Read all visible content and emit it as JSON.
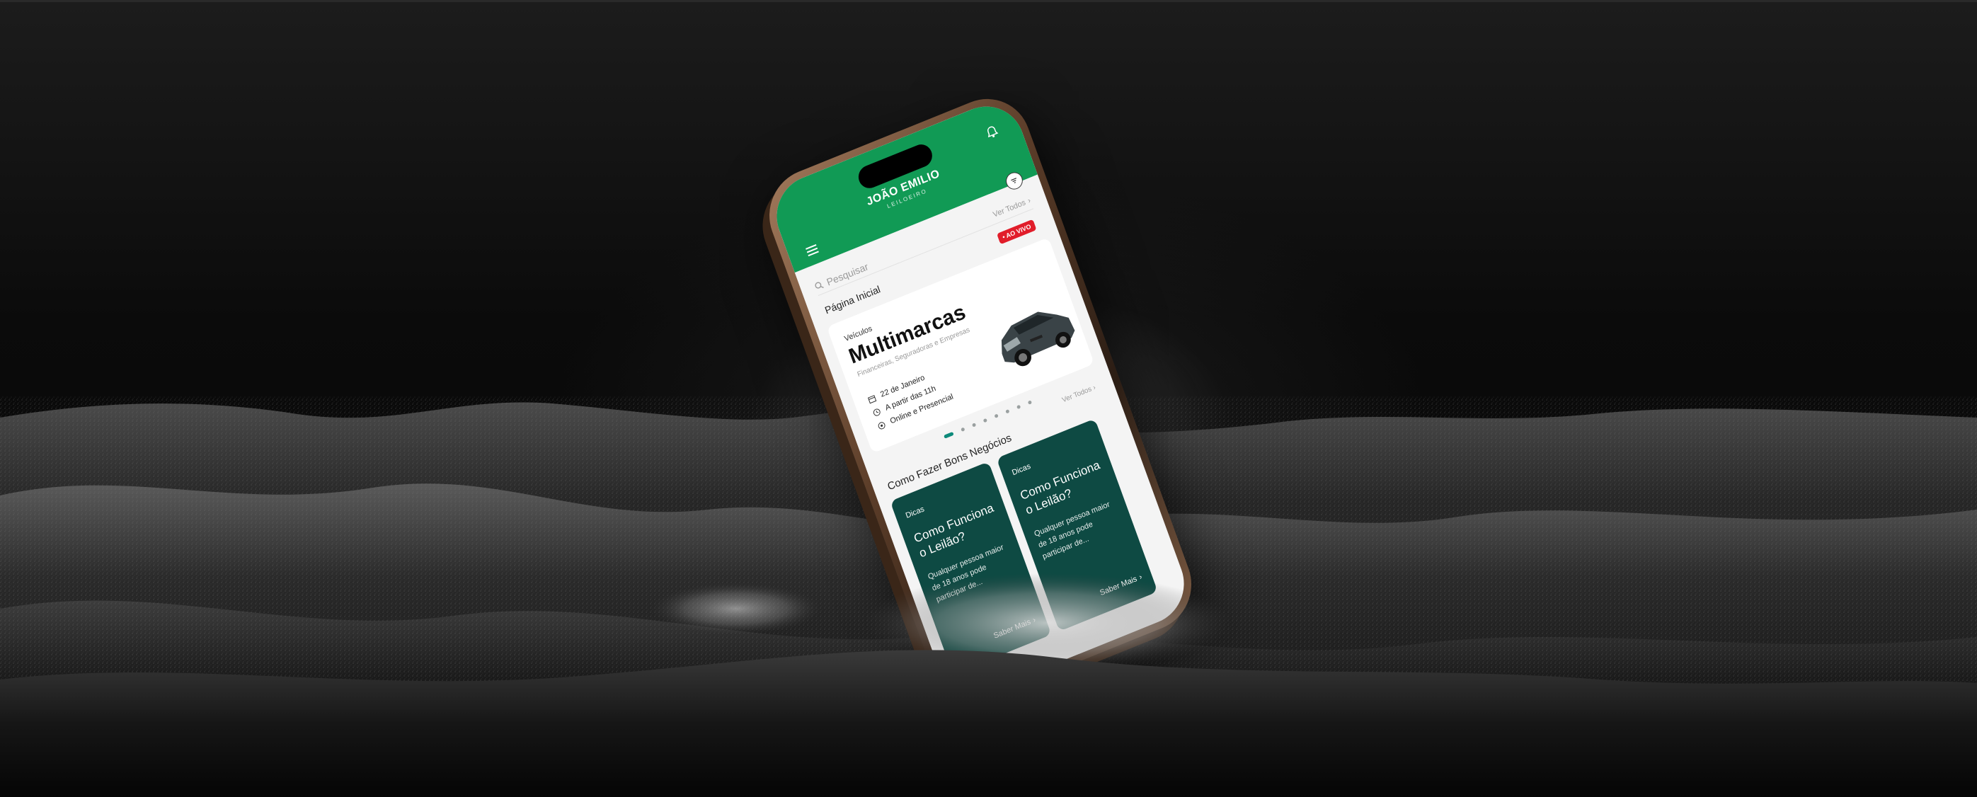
{
  "header": {
    "brand_name": "JOÃO EMILIO",
    "brand_sub": "LEILOEIRO"
  },
  "search": {
    "placeholder": "Pesquisar",
    "see_all": "Ver Todos"
  },
  "page": {
    "title": "Página Inicial"
  },
  "live_badge": "• AO VIVO",
  "event": {
    "category": "Veículos",
    "title": "Multimarcas",
    "subtitle": "Financeiras, Seguradoras e Empresas",
    "date": "22 de Janeiro",
    "time": "A partir das 11h",
    "mode": "Online e Presencial"
  },
  "carousel": {
    "dot_count": 8,
    "active_index": 0,
    "see_all": "Ver Todos"
  },
  "tips_section": {
    "title": "Como Fazer Bons Negócios",
    "cards": [
      {
        "tag": "Dicas",
        "title": "Como Funciona o Leilão?",
        "description": "Qualquer pessoa maior de 18 anos pode participar de...",
        "more": "Saber Mais"
      },
      {
        "tag": "Dicas",
        "title": "Como Funciona o Leilão?",
        "description": "Qualquer pessoa maior de 18 anos pode participar de...",
        "more": "Saber Mais"
      }
    ]
  },
  "colors": {
    "header_green": "#119a55",
    "card_teal": "#0e4a43",
    "live_red": "#e11d2a",
    "phone_frame": "#5a3c28"
  },
  "icons": [
    "menu-icon",
    "bell-icon",
    "filter-icon",
    "search-icon",
    "chevron-right-icon",
    "calendar-icon",
    "clock-icon",
    "location-icon"
  ]
}
